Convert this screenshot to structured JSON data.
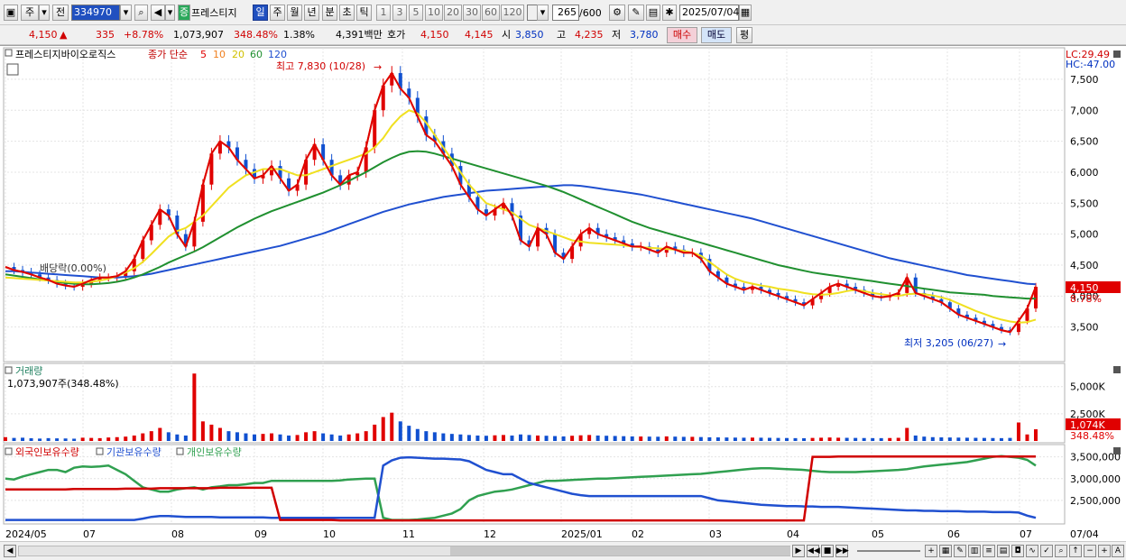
{
  "toolbar": {
    "type_label": "주",
    "prev_label": "전",
    "code": "334970",
    "name": "프레스티지",
    "rise_label": "증",
    "periods": [
      "일",
      "주",
      "월",
      "년",
      "분",
      "초",
      "틱"
    ],
    "minutes": [
      "1",
      "3",
      "5",
      "10",
      "20",
      "30",
      "60",
      "120"
    ],
    "count": "265",
    "count_total": "/600",
    "date": "2025/07/04"
  },
  "quote": {
    "price": "4,150",
    "arrow": "▲",
    "change": "335",
    "change_pct": "+8.78%",
    "volume": "1,073,907",
    "vol_ratio": "348.48%",
    "turnover": "1.38%",
    "amount": "4,391백만",
    "hoga_label": "호가",
    "ask": "4,150",
    "bid": "4,145",
    "open_label": "시",
    "open": "3,850",
    "high_label": "고",
    "high": "4,235",
    "low_label": "저",
    "low": "3,780",
    "buy_label": "매수",
    "sell_label": "매도",
    "eval_label": "평"
  },
  "chart_data": {
    "type": "line",
    "title": "프레스티지바이오로직스",
    "legend": {
      "price_label": "종가 단순",
      "ma": [
        {
          "name": "5",
          "color": "#e00000"
        },
        {
          "name": "10",
          "color": "#f08020"
        },
        {
          "name": "20",
          "color": "#f0e020"
        },
        {
          "name": "60",
          "color": "#209030"
        },
        {
          "name": "120",
          "color": "#2050d0"
        }
      ]
    },
    "top_right": {
      "lc": "LC:29.49",
      "hc": "HC:-47.00"
    },
    "price_axis": {
      "ticks": [
        "7,500",
        "7,000",
        "6,500",
        "6,000",
        "5,500",
        "5,000",
        "4,500",
        "4,000",
        "3,500"
      ],
      "values": [
        7500,
        7000,
        6500,
        6000,
        5500,
        5000,
        4500,
        4000,
        3500
      ],
      "ylim": [
        3000,
        7950
      ]
    },
    "current_price_label": "4,150",
    "current_pct_label": "8.78%",
    "annotations": {
      "high": "최고 7,830 (10/28)",
      "low": "최저 3,205 (06/27)",
      "dividend": "배당락(0.00%)"
    },
    "x_labels": [
      "2024/05",
      "07",
      "08",
      "09",
      "10",
      "11",
      "12",
      "2025/01",
      "02",
      "03",
      "04",
      "05",
      "06",
      "07",
      "07/04"
    ],
    "price_series": [
      4470,
      4420,
      4390,
      4350,
      4300,
      4260,
      4200,
      4170,
      4150,
      4200,
      4260,
      4300,
      4300,
      4320,
      4400,
      4600,
      4900,
      5150,
      5400,
      5300,
      5000,
      4800,
      5200,
      5800,
      6300,
      6500,
      6400,
      6200,
      6050,
      5900,
      5950,
      6100,
      5900,
      5700,
      5800,
      6200,
      6450,
      6200,
      5950,
      5800,
      5950,
      6000,
      6400,
      7000,
      7400,
      7600,
      7350,
      7200,
      6900,
      6600,
      6500,
      6300,
      6100,
      5800,
      5600,
      5400,
      5300,
      5400,
      5500,
      5300,
      4900,
      4800,
      5100,
      5000,
      4700,
      4600,
      4800,
      5000,
      5100,
      5000,
      4950,
      4900,
      4850,
      4800,
      4800,
      4750,
      4700,
      4800,
      4750,
      4700,
      4700,
      4600,
      4400,
      4300,
      4200,
      4150,
      4100,
      4150,
      4100,
      4050,
      4000,
      3950,
      3900,
      3850,
      3950,
      4050,
      4150,
      4200,
      4150,
      4100,
      4050,
      4000,
      3980,
      4000,
      4050,
      4300,
      4050,
      4000,
      3950,
      3900,
      3800,
      3700,
      3650,
      3600,
      3550,
      3500,
      3450,
      3420,
      3600,
      3800,
      4150
    ],
    "ma20_series": [
      4300,
      4290,
      4280,
      4270,
      4260,
      4250,
      4240,
      4230,
      4220,
      4220,
      4230,
      4250,
      4280,
      4320,
      4380,
      4450,
      4550,
      4680,
      4820,
      4960,
      5050,
      5100,
      5200,
      5300,
      5450,
      5600,
      5750,
      5850,
      5950,
      6000,
      6050,
      6050,
      6050,
      6000,
      5950,
      5950,
      6000,
      6050,
      6100,
      6150,
      6200,
      6250,
      6300,
      6400,
      6550,
      6750,
      6900,
      7000,
      6950,
      6800,
      6600,
      6400,
      6200,
      6000,
      5800,
      5650,
      5500,
      5450,
      5400,
      5350,
      5250,
      5150,
      5100,
      5050,
      5000,
      4950,
      4900,
      4880,
      4860,
      4850,
      4840,
      4830,
      4820,
      4800,
      4790,
      4780,
      4770,
      4760,
      4750,
      4730,
      4700,
      4650,
      4550,
      4450,
      4350,
      4280,
      4230,
      4200,
      4170,
      4150,
      4120,
      4100,
      4080,
      4050,
      4030,
      4020,
      4030,
      4050,
      4080,
      4100,
      4080,
      4050,
      4030,
      4010,
      4000,
      4030,
      4040,
      4030,
      4010,
      3980,
      3940,
      3880,
      3820,
      3760,
      3710,
      3660,
      3620,
      3590,
      3570,
      3580,
      3620
    ],
    "ma60_series": [
      4350,
      4330,
      4310,
      4290,
      4270,
      4250,
      4230,
      4210,
      4200,
      4190,
      4190,
      4200,
      4210,
      4230,
      4260,
      4300,
      4350,
      4410,
      4470,
      4540,
      4600,
      4660,
      4720,
      4790,
      4870,
      4950,
      5030,
      5110,
      5180,
      5250,
      5310,
      5370,
      5420,
      5470,
      5520,
      5570,
      5620,
      5670,
      5730,
      5790,
      5860,
      5930,
      6000,
      6080,
      6160,
      6230,
      6290,
      6330,
      6340,
      6330,
      6300,
      6260,
      6220,
      6180,
      6140,
      6100,
      6060,
      6020,
      5980,
      5940,
      5900,
      5860,
      5820,
      5780,
      5730,
      5680,
      5620,
      5560,
      5500,
      5440,
      5380,
      5320,
      5260,
      5200,
      5150,
      5100,
      5060,
      5020,
      4980,
      4940,
      4900,
      4860,
      4820,
      4780,
      4740,
      4700,
      4660,
      4620,
      4580,
      4540,
      4500,
      4470,
      4440,
      4410,
      4380,
      4360,
      4340,
      4320,
      4300,
      4280,
      4260,
      4240,
      4220,
      4200,
      4180,
      4160,
      4140,
      4120,
      4100,
      4080,
      4060,
      4050,
      4040,
      4030,
      4020,
      4000,
      3990,
      3980,
      3970,
      3960,
      3960
    ],
    "ma120_series": [
      4400,
      4400,
      4390,
      4380,
      4370,
      4360,
      4350,
      4340,
      4330,
      4320,
      4310,
      4300,
      4300,
      4300,
      4310,
      4320,
      4340,
      4360,
      4390,
      4420,
      4450,
      4480,
      4510,
      4540,
      4570,
      4600,
      4630,
      4660,
      4690,
      4720,
      4750,
      4780,
      4810,
      4850,
      4890,
      4930,
      4970,
      5010,
      5060,
      5110,
      5160,
      5210,
      5260,
      5310,
      5360,
      5400,
      5440,
      5480,
      5510,
      5540,
      5570,
      5600,
      5620,
      5640,
      5660,
      5680,
      5700,
      5710,
      5720,
      5730,
      5740,
      5750,
      5760,
      5770,
      5780,
      5790,
      5790,
      5780,
      5760,
      5740,
      5720,
      5700,
      5680,
      5660,
      5640,
      5610,
      5580,
      5550,
      5520,
      5490,
      5460,
      5430,
      5400,
      5370,
      5340,
      5310,
      5280,
      5250,
      5210,
      5170,
      5130,
      5090,
      5050,
      5010,
      4970,
      4930,
      4890,
      4850,
      4810,
      4770,
      4730,
      4690,
      4650,
      4610,
      4580,
      4550,
      4520,
      4490,
      4460,
      4430,
      4400,
      4370,
      4340,
      4320,
      4300,
      4280,
      4260,
      4240,
      4220,
      4200,
      4190
    ],
    "volume": {
      "label": "거래량",
      "value_label": "1,073,907주(348.48%)",
      "ticks": [
        "5,000K",
        "2,500K"
      ],
      "tick_values": [
        5000,
        2500
      ],
      "ylim": [
        0,
        6800
      ],
      "current_label": "1,074K",
      "current_pct": "348.48%",
      "values": [
        350,
        280,
        300,
        250,
        220,
        260,
        240,
        230,
        210,
        300,
        280,
        260,
        320,
        350,
        400,
        500,
        700,
        900,
        1200,
        800,
        600,
        500,
        6200,
        1800,
        1500,
        1200,
        900,
        800,
        700,
        600,
        650,
        700,
        600,
        500,
        550,
        800,
        900,
        700,
        600,
        500,
        600,
        700,
        900,
        1500,
        2200,
        2600,
        1800,
        1400,
        1100,
        900,
        800,
        700,
        650,
        600,
        550,
        500,
        480,
        520,
        550,
        500,
        600,
        550,
        500,
        480,
        450,
        420,
        480,
        520,
        550,
        500,
        480,
        460,
        440,
        420,
        410,
        400,
        390,
        420,
        400,
        380,
        380,
        360,
        340,
        330,
        320,
        310,
        300,
        310,
        300,
        290,
        280,
        270,
        260,
        250,
        280,
        300,
        320,
        300,
        290,
        280,
        270,
        260,
        260,
        270,
        290,
        1200,
        500,
        400,
        350,
        330,
        320,
        310,
        300,
        290,
        280,
        270,
        260,
        280,
        1700,
        600,
        1074
      ]
    },
    "holdings": {
      "labels": [
        "외국인보유수량",
        "기관보유수량",
        "개인보유수량"
      ],
      "colors": [
        "#d00000",
        "#2050d0",
        "#30a050"
      ],
      "ticks": [
        "3,500,000",
        "3,000,000",
        "2,500,000"
      ],
      "tick_values": [
        3500000,
        3000000,
        2500000
      ],
      "ylim": [
        2000000,
        3700000
      ],
      "foreign": [
        2750000,
        2750000,
        2750000,
        2750000,
        2750000,
        2750000,
        2750000,
        2750000,
        2760000,
        2760000,
        2760000,
        2760000,
        2760000,
        2760000,
        2770000,
        2770000,
        2770000,
        2770000,
        2780000,
        2780000,
        2780000,
        2780000,
        2780000,
        2780000,
        2780000,
        2790000,
        2790000,
        2790000,
        2790000,
        2790000,
        2790000,
        2790000,
        2050000,
        2050000,
        2050000,
        2050000,
        2050000,
        2050000,
        2050000,
        2040000,
        2040000,
        2040000,
        2040000,
        2040000,
        2040000,
        2040000,
        2040000,
        2040000,
        2040000,
        2040000,
        2040000,
        2040000,
        2040000,
        2040000,
        2040000,
        2040000,
        2040000,
        2040000,
        2040000,
        2040000,
        2040000,
        2040000,
        2040000,
        2040000,
        2040000,
        2040000,
        2040000,
        2040000,
        2040000,
        2040000,
        2040000,
        2040000,
        2040000,
        2040000,
        2040000,
        2040000,
        2040000,
        2040000,
        2040000,
        2040000,
        2040000,
        2040000,
        2040000,
        2040000,
        2040000,
        2040000,
        2040000,
        2040000,
        2040000,
        2040000,
        2040000,
        2040000,
        2040000,
        2040000,
        3500000,
        3500000,
        3500000,
        3510000,
        3510000,
        3510000,
        3510000,
        3510000,
        3510000,
        3510000,
        3510000,
        3510000,
        3510000,
        3510000,
        3510000,
        3510000,
        3510000,
        3510000,
        3510000,
        3510000,
        3510000,
        3510000,
        3510000,
        3510000,
        3510000,
        3510000,
        3510000
      ],
      "institution": [
        2050000,
        2050000,
        2050000,
        2050000,
        2050000,
        2050000,
        2050000,
        2050000,
        2050000,
        2050000,
        2050000,
        2050000,
        2050000,
        2050000,
        2050000,
        2050000,
        2080000,
        2120000,
        2140000,
        2140000,
        2130000,
        2120000,
        2120000,
        2120000,
        2120000,
        2110000,
        2110000,
        2110000,
        2110000,
        2110000,
        2110000,
        2100000,
        2100000,
        2100000,
        2100000,
        2100000,
        2100000,
        2100000,
        2100000,
        2100000,
        2100000,
        2100000,
        2100000,
        2100000,
        3300000,
        3420000,
        3480000,
        3490000,
        3480000,
        3470000,
        3460000,
        3460000,
        3450000,
        3440000,
        3400000,
        3300000,
        3200000,
        3150000,
        3100000,
        3100000,
        3000000,
        2900000,
        2850000,
        2800000,
        2750000,
        2700000,
        2650000,
        2620000,
        2600000,
        2600000,
        2600000,
        2600000,
        2600000,
        2600000,
        2600000,
        2600000,
        2600000,
        2600000,
        2600000,
        2600000,
        2600000,
        2600000,
        2550000,
        2500000,
        2480000,
        2460000,
        2440000,
        2420000,
        2400000,
        2390000,
        2380000,
        2370000,
        2370000,
        2360000,
        2360000,
        2350000,
        2350000,
        2350000,
        2340000,
        2330000,
        2320000,
        2310000,
        2300000,
        2290000,
        2280000,
        2270000,
        2270000,
        2260000,
        2260000,
        2250000,
        2250000,
        2250000,
        2240000,
        2240000,
        2240000,
        2230000,
        2230000,
        2230000,
        2220000,
        2150000,
        2100000
      ],
      "individual": [
        3000000,
        2980000,
        3050000,
        3100000,
        3150000,
        3200000,
        3200000,
        3150000,
        3250000,
        3280000,
        3270000,
        3280000,
        3300000,
        3200000,
        3100000,
        2950000,
        2800000,
        2750000,
        2700000,
        2700000,
        2750000,
        2780000,
        2800000,
        2750000,
        2800000,
        2820000,
        2850000,
        2850000,
        2870000,
        2900000,
        2900000,
        2950000,
        2950000,
        2950000,
        2950000,
        2950000,
        2950000,
        2950000,
        2950000,
        2960000,
        2980000,
        2990000,
        3000000,
        3000000,
        2100000,
        2050000,
        2050000,
        2050000,
        2060000,
        2080000,
        2100000,
        2150000,
        2200000,
        2300000,
        2500000,
        2600000,
        2650000,
        2700000,
        2720000,
        2750000,
        2800000,
        2850000,
        2900000,
        2950000,
        2950000,
        2960000,
        2970000,
        2980000,
        2990000,
        3000000,
        3000000,
        3010000,
        3020000,
        3030000,
        3040000,
        3050000,
        3060000,
        3070000,
        3080000,
        3090000,
        3100000,
        3110000,
        3130000,
        3150000,
        3170000,
        3190000,
        3210000,
        3230000,
        3240000,
        3240000,
        3230000,
        3220000,
        3210000,
        3200000,
        3180000,
        3160000,
        3150000,
        3150000,
        3150000,
        3150000,
        3160000,
        3170000,
        3180000,
        3190000,
        3200000,
        3220000,
        3250000,
        3280000,
        3300000,
        3320000,
        3340000,
        3360000,
        3380000,
        3420000,
        3460000,
        3500000,
        3520000,
        3500000,
        3480000,
        3430000,
        3300000
      ]
    }
  }
}
